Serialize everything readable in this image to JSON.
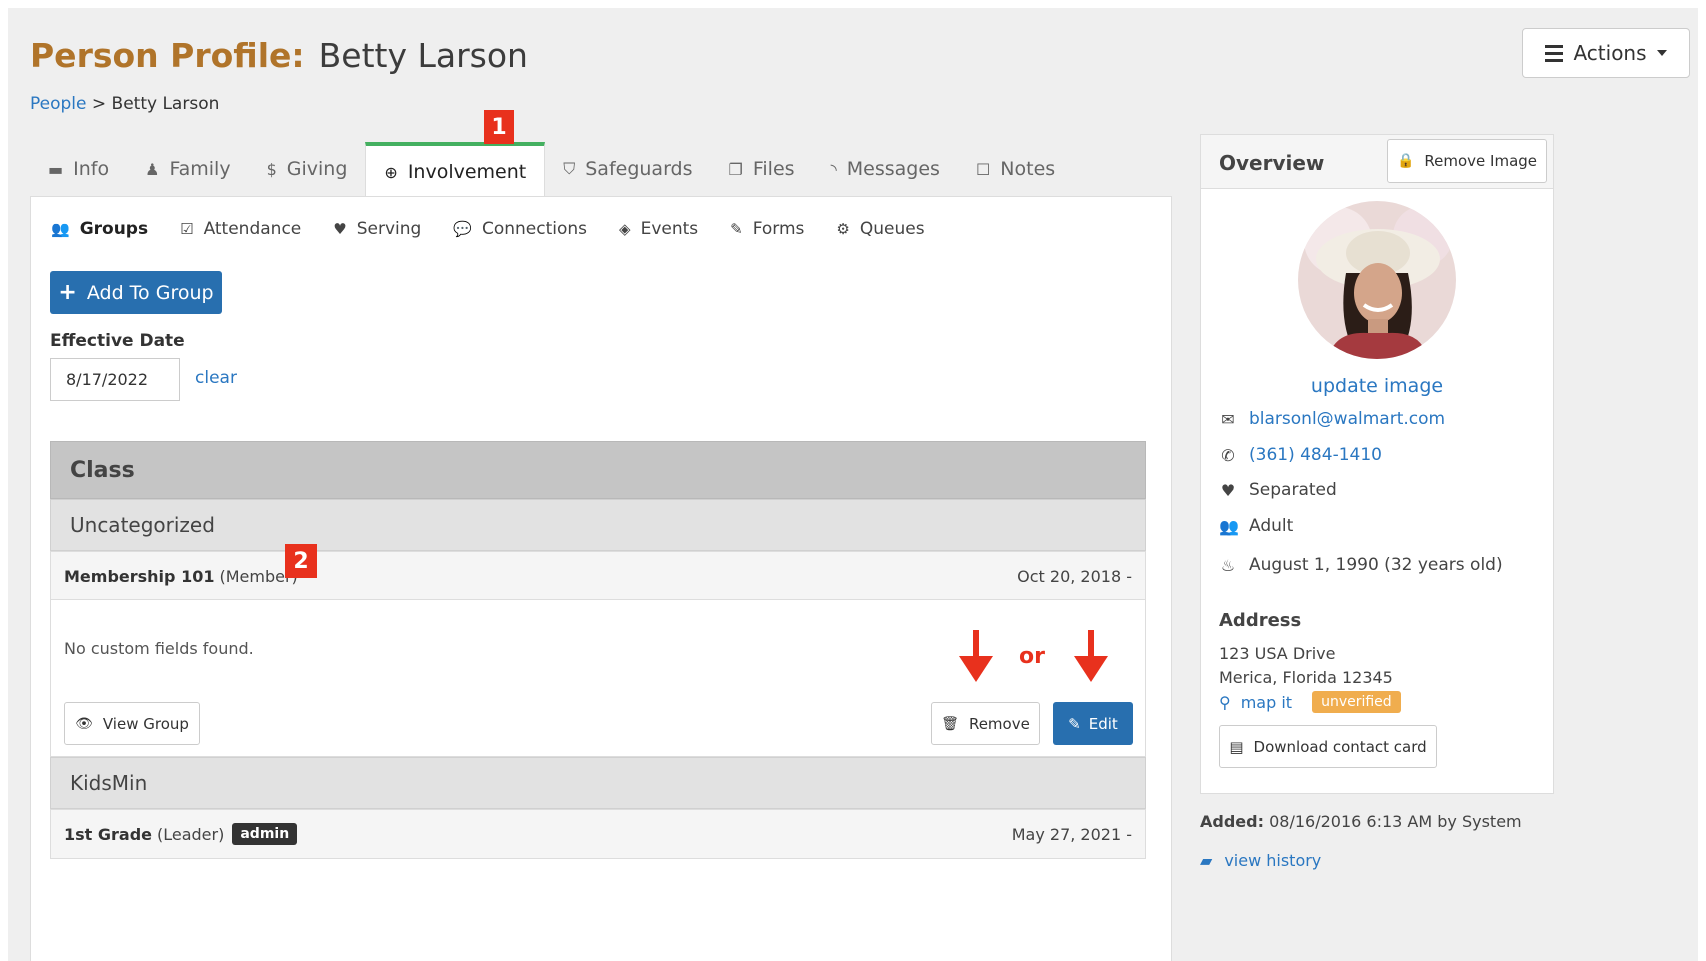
{
  "header": {
    "title_label": "Person Profile:",
    "person_name": "Betty Larson",
    "breadcrumb": {
      "root": "People",
      "separator": ">",
      "current": "Betty Larson"
    },
    "actions_label": "Actions"
  },
  "tabs": [
    {
      "label": "Info",
      "icon": "folder-open-icon"
    },
    {
      "label": "Family",
      "icon": "family-icon"
    },
    {
      "label": "Giving",
      "icon": "dollar-icon"
    },
    {
      "label": "Involvement",
      "icon": "life-ring-icon",
      "active": true
    },
    {
      "label": "Safeguards",
      "icon": "shield-icon"
    },
    {
      "label": "Files",
      "icon": "files-icon"
    },
    {
      "label": "Messages",
      "icon": "rss-icon"
    },
    {
      "label": "Notes",
      "icon": "sticky-note-icon"
    }
  ],
  "subtabs": [
    {
      "label": "Groups",
      "icon": "users-icon",
      "active": true
    },
    {
      "label": "Attendance",
      "icon": "calendar-check-icon"
    },
    {
      "label": "Serving",
      "icon": "heart-icon"
    },
    {
      "label": "Connections",
      "icon": "comments-icon"
    },
    {
      "label": "Events",
      "icon": "ticket-icon"
    },
    {
      "label": "Forms",
      "icon": "edit-form-icon"
    },
    {
      "label": "Queues",
      "icon": "cogs-icon"
    }
  ],
  "groups_panel": {
    "add_button": "Add To Group",
    "effective_date_label": "Effective Date",
    "effective_date_value": "8/17/2022",
    "clear_label": "clear",
    "section_title": "Class",
    "categories": [
      {
        "name": "Uncategorized",
        "groups": [
          {
            "name": "Membership 101",
            "role": "(Member)",
            "date": "Oct 20, 2018 -",
            "custom_fields_text": "No custom fields found.",
            "view_button": "View Group",
            "remove_button": "Remove",
            "edit_button": "Edit"
          }
        ]
      },
      {
        "name": "KidsMin",
        "groups": [
          {
            "name": "1st Grade",
            "role": "(Leader)",
            "badge": "admin",
            "date": "May 27, 2021 -"
          }
        ]
      }
    ]
  },
  "annotations": {
    "marker_1": "1",
    "marker_2": "2",
    "or_text": "or",
    "color": "#e8311d"
  },
  "overview": {
    "title": "Overview",
    "remove_image_button": "Remove Image",
    "update_image_link": "update image",
    "email": "blarsonl@walmart.com",
    "phone": "(361) 484-1410",
    "marital_status": "Separated",
    "age_group": "Adult",
    "birthday": "August 1, 1990 (32 years old)",
    "address_title": "Address",
    "address_line1": "123 USA Drive",
    "address_line2": "Merica, Florida 12345",
    "map_link": "map it",
    "address_status": "unverified",
    "download_button": "Download contact card"
  },
  "footer": {
    "added_label": "Added:",
    "added_value": "08/16/2016 6:13 AM by System",
    "view_history": "view history"
  },
  "colors": {
    "brand_title": "#b0742a",
    "primary": "#286faf",
    "link": "#2a77c1",
    "active_tab": "#44b060",
    "warning": "#f0ad4e"
  }
}
